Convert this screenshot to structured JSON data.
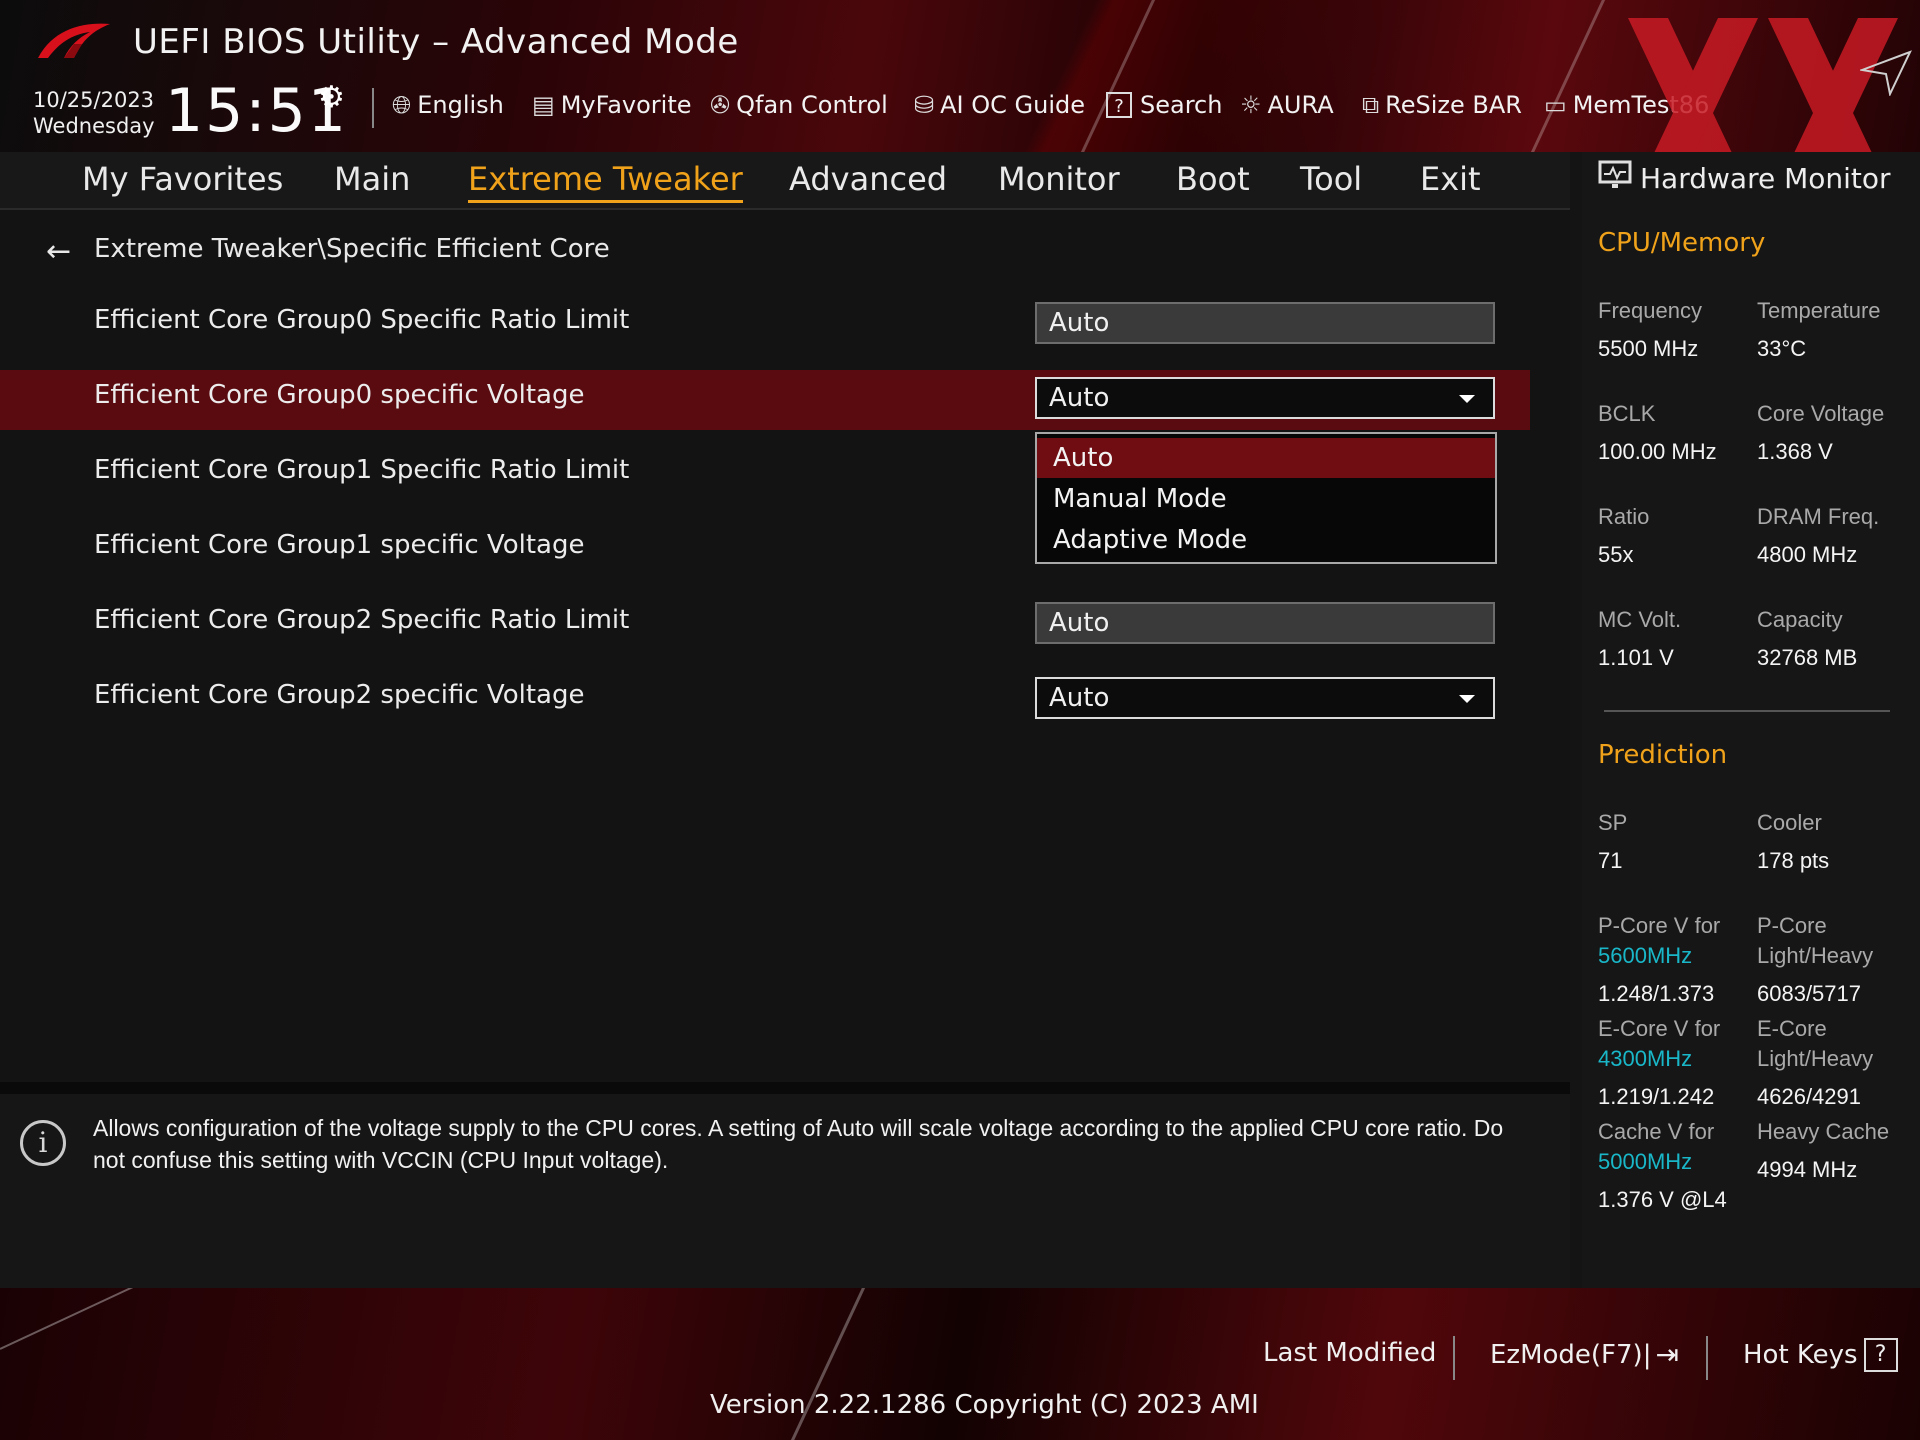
{
  "header": {
    "title": "UEFI BIOS Utility – Advanced Mode",
    "date": "10/25/2023",
    "weekday": "Wednesday",
    "time": "15:51",
    "tools": [
      {
        "label": "English",
        "icon": "globe-icon"
      },
      {
        "label": "MyFavorite",
        "icon": "favorite-list-icon"
      },
      {
        "label": "Qfan Control",
        "icon": "fan-icon"
      },
      {
        "label": "AI OC Guide",
        "icon": "ai-oc-icon"
      },
      {
        "label": "Search",
        "icon": "question-box-icon"
      },
      {
        "label": "AURA",
        "icon": "aura-light-icon"
      },
      {
        "label": "ReSize BAR",
        "icon": "resize-bar-icon"
      },
      {
        "label": "MemTest86",
        "icon": "memtest-icon"
      }
    ]
  },
  "nav": {
    "tabs": [
      "My Favorites",
      "Main",
      "Extreme Tweaker",
      "Advanced",
      "Monitor",
      "Boot",
      "Tool",
      "Exit"
    ],
    "active": "Extreme Tweaker"
  },
  "content": {
    "breadcrumb": "Extreme Tweaker\\Specific Efficient Core",
    "rows": [
      {
        "label": "Efficient Core Group0 Specific Ratio Limit",
        "value": "Auto"
      },
      {
        "label": "Efficient Core Group0 specific Voltage",
        "value": "Auto"
      },
      {
        "label": "Efficient Core Group1 Specific Ratio Limit",
        "value": ""
      },
      {
        "label": "Efficient Core Group1 specific Voltage",
        "value": ""
      },
      {
        "label": "Efficient Core Group2 Specific Ratio Limit",
        "value": "Auto"
      },
      {
        "label": "Efficient Core Group2 specific Voltage",
        "value": "Auto"
      }
    ],
    "dropdown_options": [
      "Auto",
      "Manual Mode",
      "Adaptive Mode"
    ],
    "dropdown_selected": "Auto"
  },
  "help": {
    "text": "Allows configuration of the voltage supply to the CPU cores. A setting of Auto will scale voltage according to the applied CPU core ratio.  Do not confuse this setting with VCCIN (CPU Input voltage)."
  },
  "hw_monitor": {
    "title": "Hardware Monitor",
    "cpu_memory": {
      "heading": "CPU/Memory",
      "frequency_label": "Frequency",
      "frequency": "5500 MHz",
      "temperature_label": "Temperature",
      "temperature": "33°C",
      "bclk_label": "BCLK",
      "bclk": "100.00 MHz",
      "core_voltage_label": "Core Voltage",
      "core_voltage": "1.368 V",
      "ratio_label": "Ratio",
      "ratio": "55x",
      "dram_freq_label": "DRAM Freq.",
      "dram_freq": "4800 MHz",
      "mc_volt_label": "MC Volt.",
      "mc_volt": "1.101 V",
      "capacity_label": "Capacity",
      "capacity": "32768 MB"
    },
    "prediction": {
      "heading": "Prediction",
      "sp_label": "SP",
      "sp": "71",
      "cooler_label": "Cooler",
      "cooler": "178 pts",
      "pcore_v_label": "P-Core V for",
      "pcore_v_freq": "5600MHz",
      "pcore_v": "1.248/1.373",
      "pcore_lh_label1": "P-Core",
      "pcore_lh_label2": "Light/Heavy",
      "pcore_lh": "6083/5717",
      "ecore_v_label": "E-Core V for",
      "ecore_v_freq": "4300MHz",
      "ecore_v": "1.219/1.242",
      "ecore_lh_label1": "E-Core",
      "ecore_lh_label2": "Light/Heavy",
      "ecore_lh": "4626/4291",
      "cache_v_label": "Cache V for",
      "cache_v_freq": "5000MHz",
      "cache_v": "1.376 V @L4",
      "heavy_cache_label": "Heavy Cache",
      "heavy_cache": "4994 MHz"
    }
  },
  "footer": {
    "last_modified": "Last Modified",
    "ezmode": "EzMode(F7)|",
    "hot_keys": "Hot Keys",
    "version": "Version 2.22.1286 Copyright (C) 2023 AMI"
  },
  "colors": {
    "accent": "#f0a21a",
    "highlight_row": "#5a0b10",
    "cyan": "#19b7c8"
  }
}
